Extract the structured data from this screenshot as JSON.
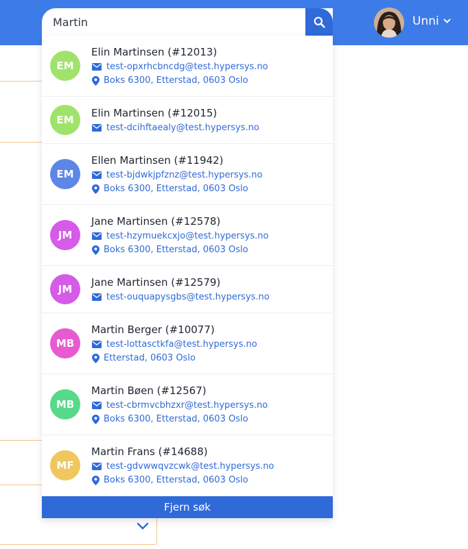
{
  "search": {
    "value": "Martin",
    "placeholder": ""
  },
  "user": {
    "name": "Unni"
  },
  "results": [
    {
      "initials": "EM",
      "avatar_color": "#a0e36a",
      "name": "Elin Martinsen (#12013)",
      "email": "test-opxrhcbncdg@test.hypersys.no",
      "address": "Boks 6300, Etterstad, 0603 Oslo"
    },
    {
      "initials": "EM",
      "avatar_color": "#a0e36a",
      "name": "Elin Martinsen (#12015)",
      "email": "test-dcihftaealy@test.hypersys.no",
      "address": ""
    },
    {
      "initials": "EM",
      "avatar_color": "#5c86e8",
      "name": "Ellen Martinsen (#11942)",
      "email": "test-bjdwkjpfznz@test.hypersys.no",
      "address": "Boks 6300, Etterstad, 0603 Oslo"
    },
    {
      "initials": "JM",
      "avatar_color": "#d55be8",
      "name": "Jane Martinsen (#12578)",
      "email": "test-hzymuekcxjo@test.hypersys.no",
      "address": "Boks 6300, Etterstad, 0603 Oslo"
    },
    {
      "initials": "JM",
      "avatar_color": "#d55be8",
      "name": "Jane Martinsen (#12579)",
      "email": "test-ouquapysgbs@test.hypersys.no",
      "address": ""
    },
    {
      "initials": "MB",
      "avatar_color": "#e85ad2",
      "name": "Martin Berger (#10077)",
      "email": "test-lottasctkfa@test.hypersys.no",
      "address": "Etterstad, 0603 Oslo"
    },
    {
      "initials": "MB",
      "avatar_color": "#57d98a",
      "name": "Martin Bøen (#12567)",
      "email": "test-cbrmvcbhzxr@test.hypersys.no",
      "address": "Boks 6300, Etterstad, 0603 Oslo"
    },
    {
      "initials": "MF",
      "avatar_color": "#f0c65e",
      "name": "Martin Frans (#14688)",
      "email": "test-gdvwwqvzcwk@test.hypersys.no",
      "address": "Boks 6300, Etterstad, 0603 Oslo"
    }
  ],
  "clear_label": "Fjern søk",
  "colors": {
    "header": "#3d7be8",
    "accent": "#2f6ad8",
    "bg_border": "#f0c48a"
  },
  "icons": {
    "search": "search-icon",
    "email": "envelope-icon",
    "address": "map-pin-icon",
    "chevron": "chevron-down-icon"
  }
}
